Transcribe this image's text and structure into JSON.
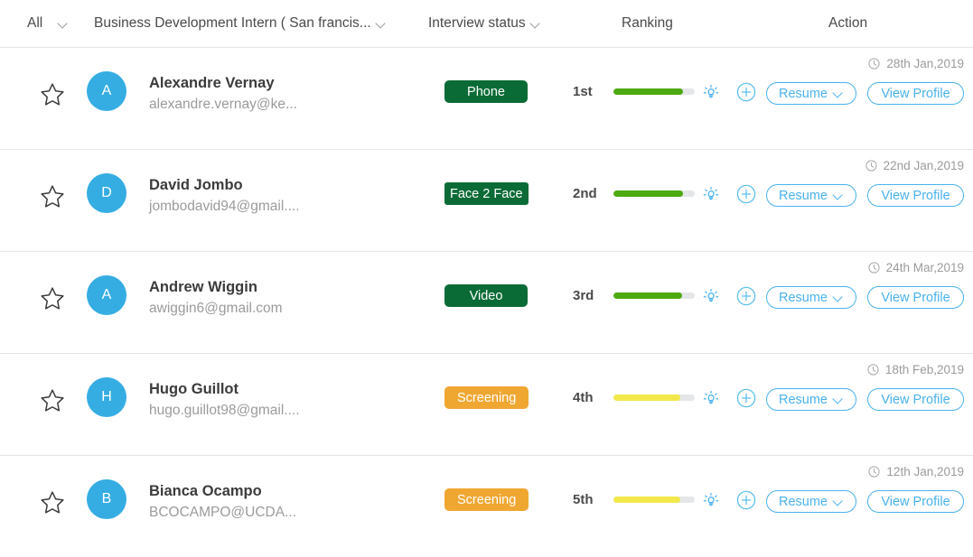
{
  "header": {
    "all_label": "All",
    "job_label": "Business Development Intern ( San francis...",
    "status_label": "Interview status",
    "ranking_label": "Ranking",
    "action_label": "Action",
    "all_caret_icon": "chevron-down-icon",
    "job_caret_icon": "chevron-down-icon",
    "status_caret_icon": "chevron-down-icon"
  },
  "colors": {
    "avatar_blue": "#35ade3",
    "accent_blue": "#49b2ec",
    "badge_green": "#0b6b36",
    "badge_orange": "#f0a732",
    "bar_green": "#4da911",
    "bar_yellow": "#f2e84b",
    "bar_track": "#e4e6e8",
    "divider": "#e4e4e4",
    "name_text": "#3b3b3b",
    "muted_text": "#9b9b9b"
  },
  "buttons": {
    "resume_label": "Resume",
    "view_profile_label": "View Profile",
    "resume_caret_icon": "chevron-down-icon",
    "add_icon": "plus-circle-icon",
    "bulb_icon": "lightbulb-icon",
    "star_icon": "star-outline-icon",
    "clock_icon": "clock-icon"
  },
  "rows": [
    {
      "initial": "A",
      "name": "Alexandre Vernay",
      "email": "alexandre.vernay@ke...",
      "status": "Phone",
      "status_color": "#0b6b36",
      "status_tight": false,
      "rank": "1st",
      "rank_percent": 86,
      "bar_color": "#4da911",
      "date": "28th Jan,2019"
    },
    {
      "initial": "D",
      "name": "David Jombo",
      "email": "jombodavid94@gmail....",
      "status": "Face 2 Face",
      "status_color": "#0b6b36",
      "status_tight": true,
      "rank": "2nd",
      "rank_percent": 86,
      "bar_color": "#4da911",
      "date": "22nd Jan,2019"
    },
    {
      "initial": "A",
      "name": "Andrew Wiggin",
      "email": "awiggin6@gmail.com",
      "status": "Video",
      "status_color": "#0b6b36",
      "status_tight": false,
      "rank": "3rd",
      "rank_percent": 84,
      "bar_color": "#4da911",
      "date": "24th Mar,2019"
    },
    {
      "initial": "H",
      "name": "Hugo Guillot",
      "email": "hugo.guillot98@gmail....",
      "status": "Screening",
      "status_color": "#f0a732",
      "status_tight": false,
      "rank": "4th",
      "rank_percent": 82,
      "bar_color": "#f2e84b",
      "date": "18th Feb,2019"
    },
    {
      "initial": "B",
      "name": "Bianca Ocampo",
      "email": "BCOCAMPO@UCDA...",
      "status": "Screening",
      "status_color": "#f0a732",
      "status_tight": false,
      "rank": "5th",
      "rank_percent": 82,
      "bar_color": "#f2e84b",
      "date": "12th Jan,2019"
    }
  ]
}
